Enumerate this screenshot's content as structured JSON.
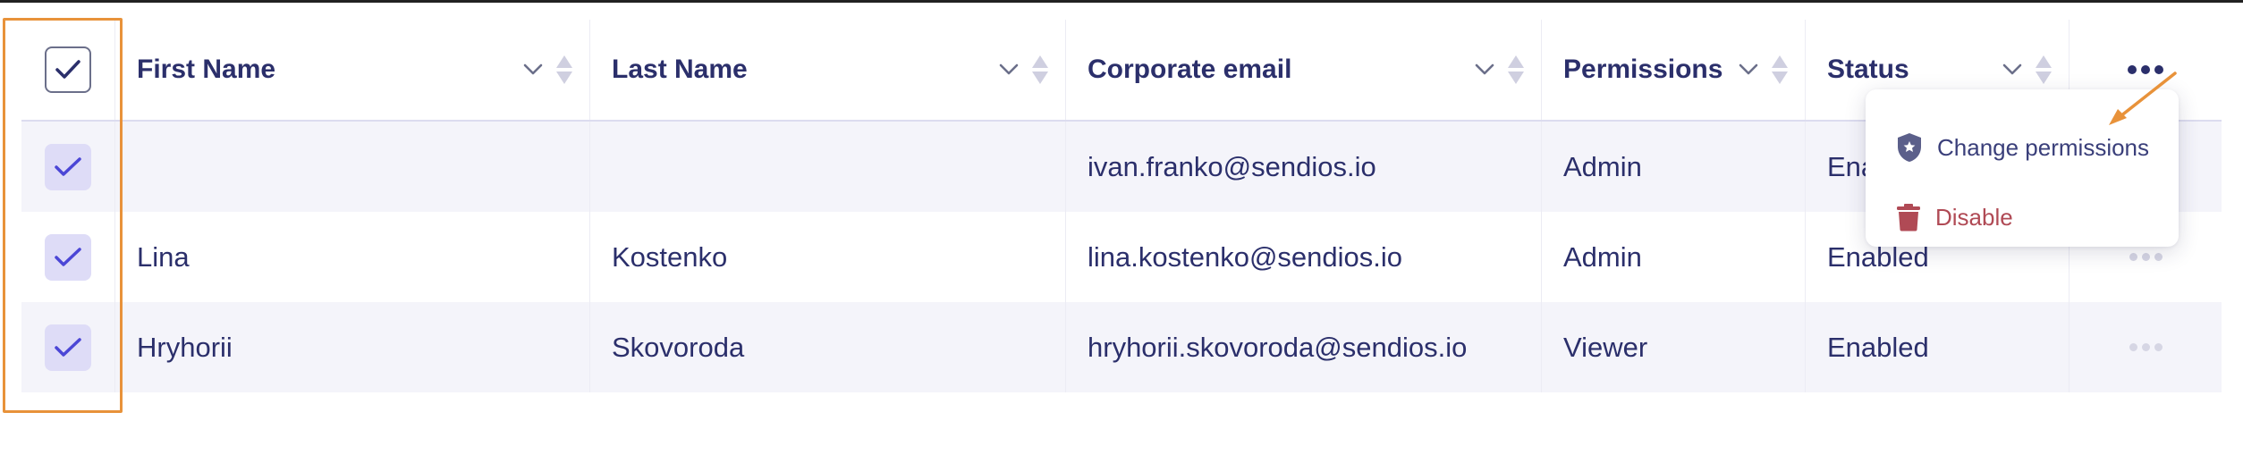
{
  "table": {
    "columns": [
      {
        "key": "first_name",
        "label": "First Name"
      },
      {
        "key": "last_name",
        "label": "Last Name"
      },
      {
        "key": "email",
        "label": "Corporate email"
      },
      {
        "key": "permissions",
        "label": "Permissions"
      },
      {
        "key": "status",
        "label": "Status"
      }
    ],
    "header_checkbox_checked": true,
    "rows": [
      {
        "selected": true,
        "first_name": "",
        "last_name": "",
        "email": "ivan.franko@sendios.io",
        "permissions": "Admin",
        "status": "Ena"
      },
      {
        "selected": true,
        "first_name": "Lina",
        "last_name": "Kostenko",
        "email": "lina.kostenko@sendios.io",
        "permissions": "Admin",
        "status": "Enabled"
      },
      {
        "selected": true,
        "first_name": "Hryhorii",
        "last_name": "Skovoroda",
        "email": "hryhorii.skovoroda@sendios.io",
        "permissions": "Viewer",
        "status": "Enabled"
      }
    ]
  },
  "context_menu": {
    "items": [
      {
        "label": "Change permissions",
        "icon": "shield-star-icon",
        "color": "#3a3f7a"
      },
      {
        "label": "Disable",
        "icon": "trash-icon",
        "color": "#b04a55"
      }
    ]
  },
  "colors": {
    "accent": "#4b46d6",
    "checkbox_bg": "#dedcf7",
    "highlight": "#e8923a",
    "text": "#2b2f6b",
    "danger": "#b04a55",
    "row_alt": "#f4f4fa"
  }
}
